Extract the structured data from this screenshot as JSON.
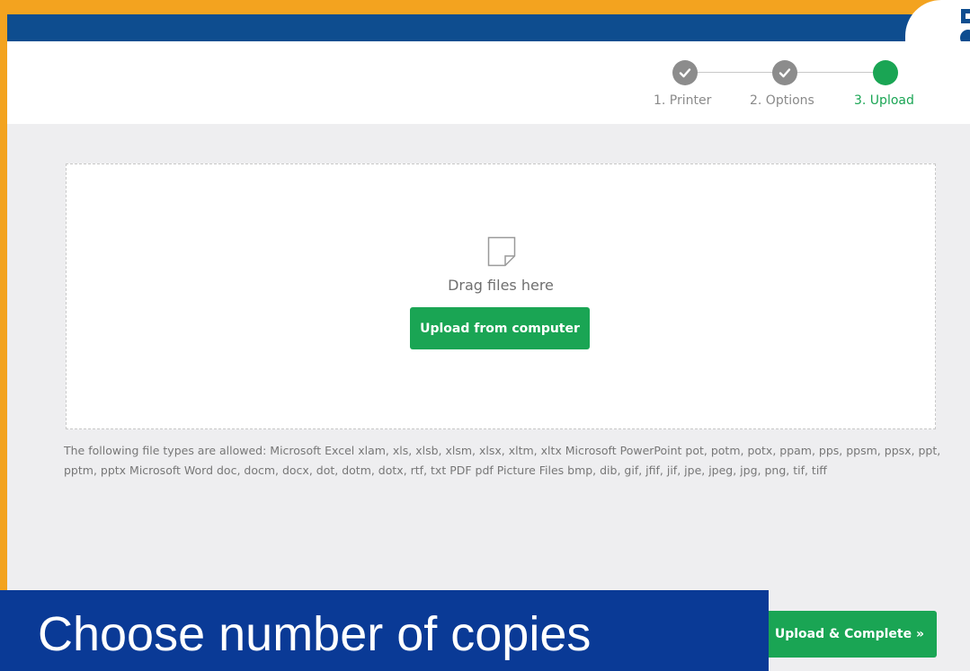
{
  "stepper": {
    "steps": [
      {
        "label": "1. Printer",
        "state": "done"
      },
      {
        "label": "2. Options",
        "state": "done"
      },
      {
        "label": "3. Upload",
        "state": "active"
      }
    ]
  },
  "dropzone": {
    "drag_text": "Drag files here",
    "upload_button": "Upload from computer",
    "icon": "file-icon"
  },
  "allowed_types_text": "The following file types are allowed: Microsoft Excel xlam, xls, xlsb, xlsm, xlsx, xltm, xltx Microsoft PowerPoint pot, potm, potx, ppam, pps, ppsm, ppsx, ppt, pptm, pptx Microsoft Word doc, docm, docx, dot, dotm, dotx, rtf, txt PDF pdf Picture Files bmp, dib, gif, jfif, jif, jpe, jpeg, jpg, png, tif, tiff",
  "complete_button": "Upload & Complete »",
  "caption": "Choose number of copies",
  "colors": {
    "accent_green": "#1aa554",
    "header_blue": "#0e4d8f",
    "frame_orange": "#f3a31f",
    "caption_blue": "#0a3a96",
    "done_grey": "#8c8c8c"
  }
}
